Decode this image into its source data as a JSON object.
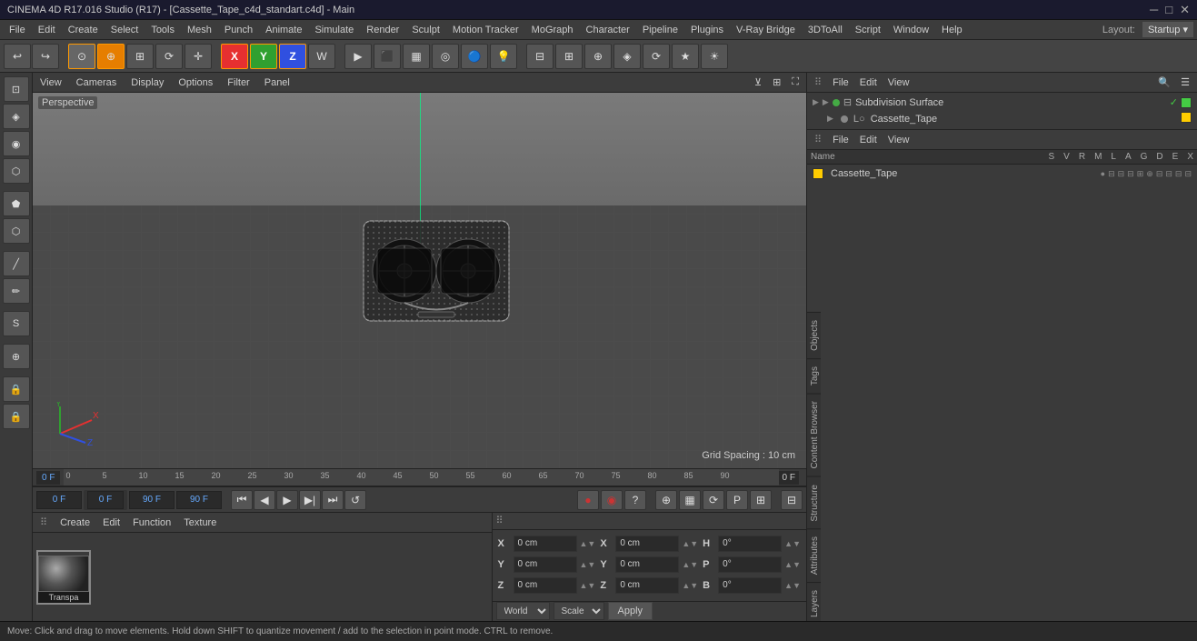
{
  "titlebar": {
    "text": "CINEMA 4D R17.016 Studio (R17) - [Cassette_Tape_c4d_standart.c4d] - Main",
    "minimize": "─",
    "maximize": "□",
    "close": "✕"
  },
  "menubar": {
    "items": [
      "File",
      "Edit",
      "Create",
      "Select",
      "Tools",
      "Mesh",
      "Punch",
      "Animate",
      "Simulate",
      "Render",
      "Sculpt",
      "Motion Tracker",
      "MoGraph",
      "Character",
      "Pipeline",
      "Plugins",
      "V-Ray Bridge",
      "3DToAll",
      "Script",
      "Window",
      "Help"
    ]
  },
  "toolbar": {
    "undo_label": "↩",
    "redo_label": "↪",
    "mode_move": "⊕",
    "mode_scale": "⊡",
    "mode_rotate": "⟳",
    "mode_transform": "⊞",
    "x_axis": "X",
    "y_axis": "Y",
    "z_axis": "Z",
    "world": "W",
    "layout": "Layout: Startup"
  },
  "viewport": {
    "tabs": [
      "View",
      "Cameras",
      "Display",
      "Options",
      "Filter",
      "Panel"
    ],
    "perspective_label": "Perspective",
    "grid_spacing": "Grid Spacing : 10 cm"
  },
  "timeline": {
    "frame_current": "0 F",
    "frame_start": "0 F",
    "frame_end": "90 F",
    "frame_end2": "90 F",
    "marks": [
      "0",
      "5",
      "10",
      "15",
      "20",
      "25",
      "30",
      "35",
      "40",
      "45",
      "50",
      "55",
      "60",
      "65",
      "70",
      "75",
      "80",
      "85",
      "90"
    ],
    "current_frame_right": "0 F"
  },
  "material_panel": {
    "toolbar_items": [
      "Create",
      "Edit",
      "Function",
      "Texture"
    ],
    "material_name": "Transpa"
  },
  "object_panel": {
    "toolbar_items": [
      "File",
      "Edit",
      "View"
    ],
    "search_placeholder": "🔍",
    "items": [
      {
        "name": "Subdivision Surface",
        "color": "#44cc44",
        "dot_color": "#44aa44",
        "has_check": true
      },
      {
        "name": "Cassette_Tape",
        "color": "#ffcc00",
        "dot_color": "#888888",
        "has_check": false
      }
    ]
  },
  "scene_panel": {
    "toolbar_items": [
      "File",
      "Edit",
      "View"
    ],
    "header": {
      "name": "Name",
      "cols": [
        "S",
        "V",
        "R",
        "M",
        "L",
        "A",
        "G",
        "D",
        "E",
        "X"
      ]
    },
    "items": [
      {
        "name": "Cassette_Tape",
        "color": "#ffcc00"
      }
    ]
  },
  "coords": {
    "x_pos": "0 cm",
    "y_pos": "0 cm",
    "z_pos": "0 cm",
    "x_size": "0 cm",
    "y_size": "0 cm",
    "z_size": "0 cm",
    "h_rot": "0°",
    "p_rot": "0°",
    "b_rot": "0°",
    "world_option": "World",
    "scale_option": "Scale",
    "apply_label": "Apply",
    "labels": {
      "x": "X",
      "y": "Y",
      "z": "Z",
      "h": "H",
      "p": "P",
      "b": "B"
    }
  },
  "right_tabs": [
    "Objects",
    "Tags",
    "Content Browser",
    "Structure",
    "Attributes",
    "Layers"
  ],
  "status_bar": {
    "text": "Move: Click and drag to move elements. Hold down SHIFT to quantize movement / add to the selection in point mode. CTRL to remove."
  }
}
